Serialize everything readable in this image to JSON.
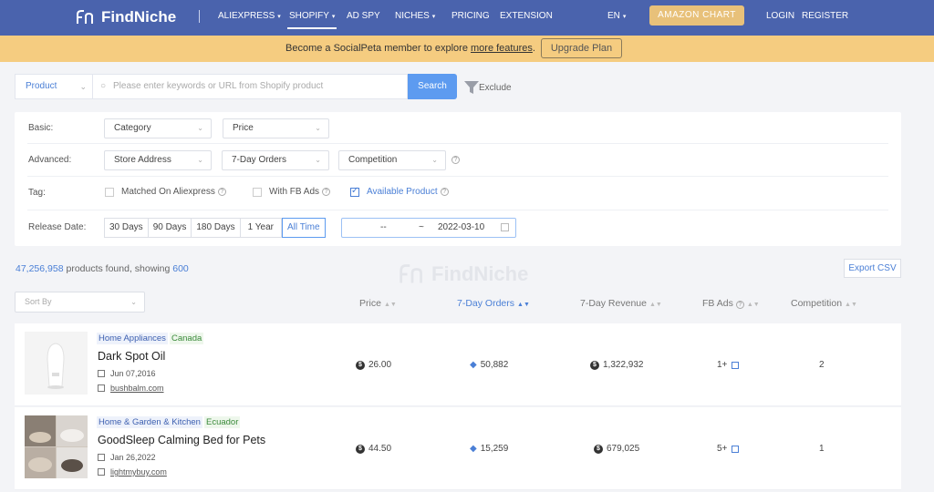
{
  "header": {
    "logo_text": "FindNiche",
    "nav": [
      {
        "label": "ALIEXPRESS",
        "caret": true
      },
      {
        "label": "SHOPIFY",
        "caret": true
      },
      {
        "label": "AD SPY",
        "caret": false
      },
      {
        "label": "NICHES",
        "caret": true
      },
      {
        "label": "PRICING",
        "caret": false
      },
      {
        "label": "EXTENSION",
        "caret": false
      }
    ],
    "lang": "EN",
    "amazon_chart": "AMAZON CHART",
    "login": "LOGIN",
    "register": "REGISTER"
  },
  "banner": {
    "text": "Become a SocialPeta member to explore ",
    "link": "more features",
    "suffix": ".",
    "upgrade": "Upgrade Plan"
  },
  "search": {
    "type": "Product",
    "placeholder": "Please enter keywords or URL from Shopify product",
    "button": "Search",
    "exclude": "Exclude"
  },
  "filters": {
    "basic_label": "Basic:",
    "category": "Category",
    "price": "Price",
    "advanced_label": "Advanced:",
    "store_address": "Store Address",
    "orders": "7-Day Orders",
    "competition": "Competition",
    "tag_label": "Tag:",
    "tags": [
      {
        "label": "Matched On Aliexpress",
        "checked": false,
        "help": true
      },
      {
        "label": "With FB Ads",
        "checked": false,
        "help": true
      },
      {
        "label": "Available Product",
        "checked": true,
        "help": true
      }
    ],
    "release_label": "Release Date:",
    "release_options": [
      "30 Days",
      "90 Days",
      "180 Days",
      "1 Year",
      "All Time"
    ],
    "release_active": "All Time",
    "date_from": "--",
    "date_sep": "~",
    "date_to": "2022-03-10"
  },
  "results": {
    "count": "47,256,958",
    "found_text": " products found, showing ",
    "showing": "600",
    "watermark": "FindNiche",
    "export": "Export CSV",
    "sort_placeholder": "Sort By"
  },
  "columns": [
    "Price",
    "7-Day Orders",
    "7-Day Revenue",
    "FB Ads",
    "Competition"
  ],
  "products": [
    {
      "category": "Home Appliances",
      "country": "Canada",
      "name": "Dark Spot Oil",
      "date": "Jun 07,2016",
      "site": "bushbalm.com",
      "price": "26.00",
      "orders": "50,882",
      "revenue": "1,322,932",
      "fb_ads": "1+",
      "competition": "2"
    },
    {
      "category": "Home & Garden & Kitchen",
      "country": "Ecuador",
      "name": "GoodSleep Calming Bed for Pets",
      "date": "Jan 26,2022",
      "site": "lightmybuy.com",
      "price": "44.50",
      "orders": "15,259",
      "revenue": "679,025",
      "fb_ads": "5+",
      "competition": "1"
    }
  ]
}
